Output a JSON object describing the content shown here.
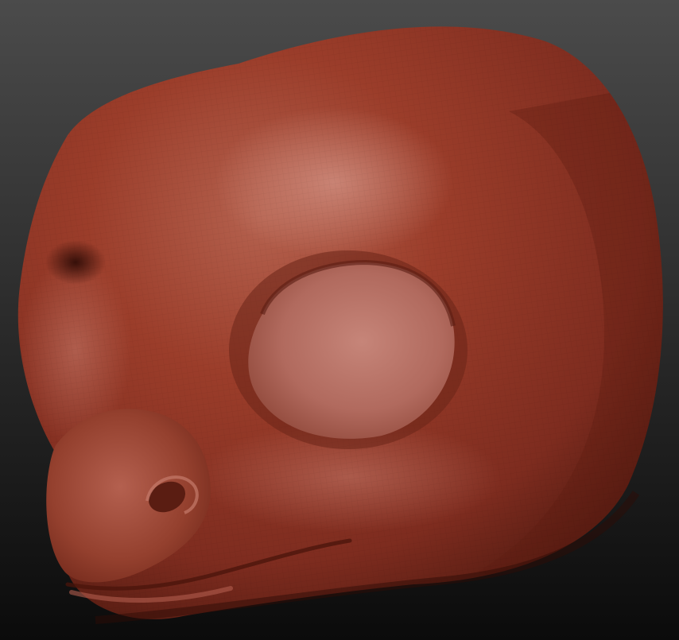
{
  "scene": {
    "subject": "clay-head-sculpt",
    "background": {
      "top": "#4b4b4b",
      "bottom": "#0b0b0b"
    },
    "material": {
      "base": "#8a3324",
      "mid": "#9b3d2a",
      "highlight": "#c47a6c",
      "shadow": "#3f130c",
      "socket": "#b56e62"
    }
  }
}
